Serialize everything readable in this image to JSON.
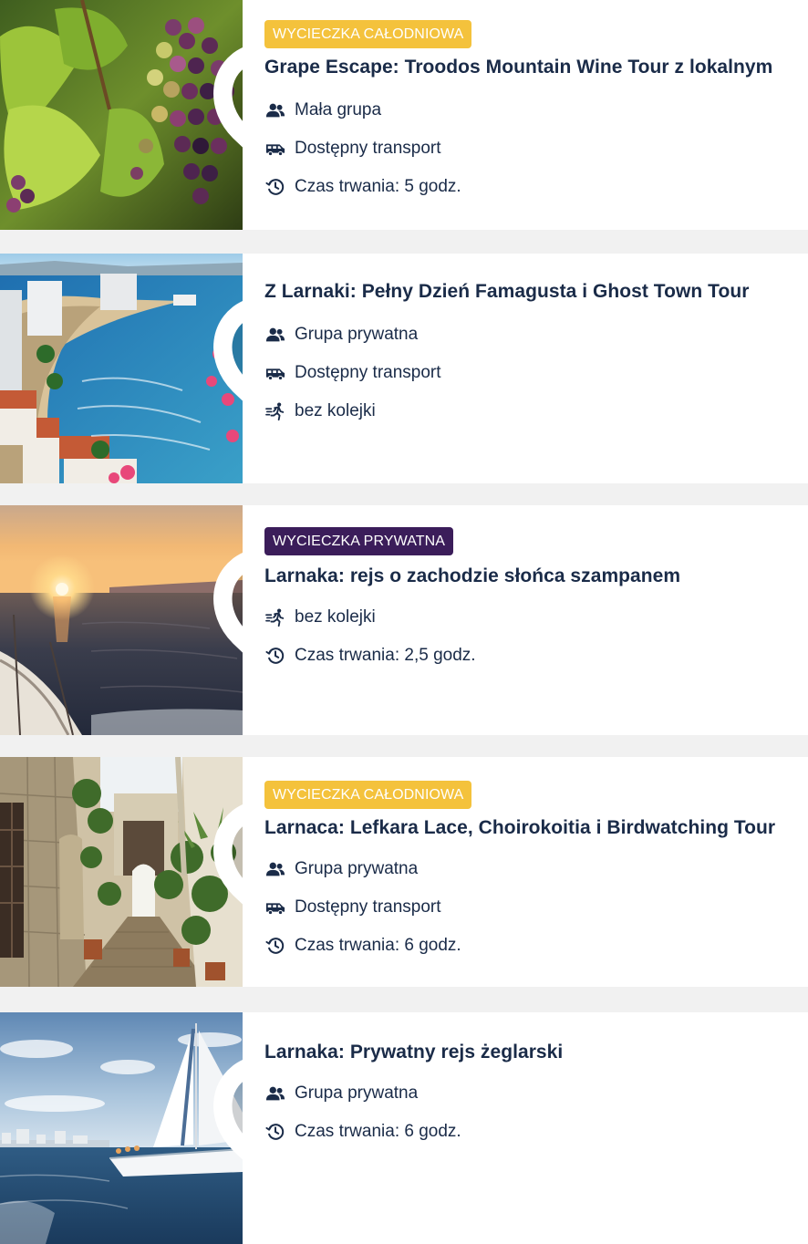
{
  "colors": {
    "badge_full_day": "#f4c23c",
    "badge_private": "#3b1d5a",
    "text": "#1a2b48",
    "card_bg": "#ffffff",
    "page_bg": "#f1f1f1"
  },
  "tours": [
    {
      "image": "vineyard-grapes-photo",
      "badge": "WYCIECZKA CAŁODNIOWA",
      "badge_style": "full-day",
      "title": "Grape Escape: Troodos Mountain Wine Tour z lokalnym",
      "features": [
        {
          "icon": "group-icon",
          "label": "Mała grupa"
        },
        {
          "icon": "transport-icon",
          "label": "Dostępny transport"
        },
        {
          "icon": "clock-icon",
          "label": "Czas trwania: 5 godz."
        }
      ]
    },
    {
      "image": "coastal-city-beach-photo",
      "badge": "",
      "badge_style": "",
      "title": "Z Larnaki: Pełny Dzień Famagusta i Ghost Town Tour",
      "features": [
        {
          "icon": "group-icon",
          "label": "Grupa prywatna"
        },
        {
          "icon": "transport-icon",
          "label": "Dostępny transport"
        },
        {
          "icon": "skip-line-icon",
          "label": "bez kolejki"
        }
      ]
    },
    {
      "image": "sunset-sea-boat-photo",
      "badge": "WYCIECZKA PRYWATNA",
      "badge_style": "private",
      "title": "Larnaka: rejs o zachodzie słońca szampanem",
      "features": [
        {
          "icon": "skip-line-icon",
          "label": "bez kolejki"
        },
        {
          "icon": "clock-icon",
          "label": "Czas trwania: 2,5 godz."
        }
      ]
    },
    {
      "image": "stone-alley-village-photo",
      "badge": "WYCIECZKA CAŁODNIOWA",
      "badge_style": "full-day",
      "title": "Larnaca: Lefkara Lace, Choirokoitia i Birdwatching Tour",
      "features": [
        {
          "icon": "group-icon",
          "label": "Grupa prywatna"
        },
        {
          "icon": "transport-icon",
          "label": "Dostępny transport"
        },
        {
          "icon": "clock-icon",
          "label": "Czas trwania: 6 godz."
        }
      ]
    },
    {
      "image": "sailing-yacht-photo",
      "badge": "",
      "badge_style": "",
      "title": "Larnaka: Prywatny rejs żeglarski",
      "features": [
        {
          "icon": "group-icon",
          "label": "Grupa prywatna"
        },
        {
          "icon": "clock-icon",
          "label": "Czas trwania: 6 godz."
        }
      ]
    }
  ]
}
